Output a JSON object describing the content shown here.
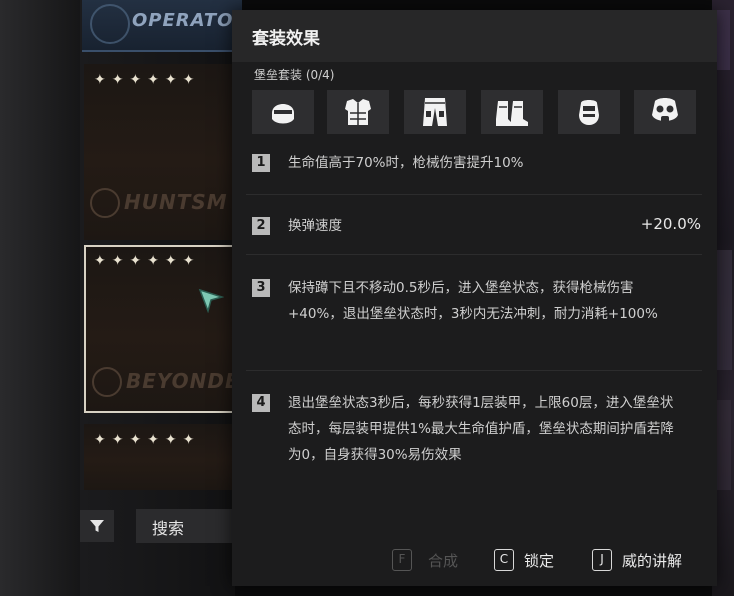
{
  "background": {
    "operator_banner": "OPERATO",
    "cards": [
      {
        "stars": "✦✦✦✦✦✦",
        "watermark": "HUNTSM"
      },
      {
        "stars": "✦✦✦✦✦✦",
        "watermark": "BEYONDE"
      },
      {
        "stars": "✦✦✦✦✦✦",
        "watermark": ""
      }
    ],
    "search_label": "搜索"
  },
  "panel": {
    "title": "套装效果",
    "set_name": "堡垒套装 (0/4)",
    "pieces": [
      "helmet-icon",
      "armor-vest-icon",
      "pants-icon",
      "boots-icon",
      "glove-icon",
      "gas-mask-icon"
    ],
    "effects": [
      {
        "num": "1",
        "text": "生命值高于70%时，枪械伤害提升10%",
        "value": ""
      },
      {
        "num": "2",
        "text": "换弹速度",
        "value": "+20.0%"
      },
      {
        "num": "3",
        "text": "保持蹲下且不移动0.5秒后，进入堡垒状态，获得枪械伤害+40%，退出堡垒状态时，3秒内无法冲刺，耐力消耗+100%",
        "value": ""
      },
      {
        "num": "4",
        "text": "退出堡垒状态3秒后，每秒获得1层装甲，上限60层，进入堡垒状态时，每层装甲提供1%最大生命值护盾，堡垒状态期间护盾若降为0，自身获得30%易伤效果",
        "value": ""
      }
    ],
    "actions": [
      {
        "key": "F",
        "label": "合成",
        "enabled": false
      },
      {
        "key": "C",
        "label": "锁定",
        "enabled": true
      },
      {
        "key": "J",
        "label": "威的讲解",
        "enabled": true
      }
    ]
  },
  "colors": {
    "panel_bg": "#1c1c1d",
    "header_bg": "#272728",
    "selected_border": "#d8d2c4",
    "cursor": "#7fc9b4"
  }
}
